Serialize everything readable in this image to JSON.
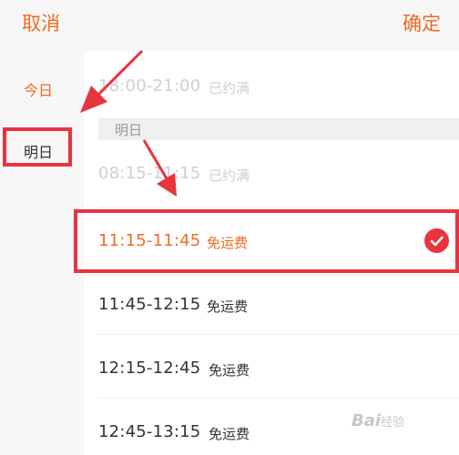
{
  "header": {
    "cancel_label": "取消",
    "confirm_label": "确定"
  },
  "sidebar": {
    "items": [
      {
        "label": "今日"
      },
      {
        "label": "明日"
      }
    ]
  },
  "slots": {
    "today": [
      {
        "time": "18:00-21:00",
        "status": "已约满"
      }
    ],
    "tomorrow_header": "明日",
    "tomorrow": [
      {
        "time": "08:15-11:15",
        "status": "已约满"
      },
      {
        "time": "11:15-11:45",
        "status": "免运费"
      },
      {
        "time": "11:45-12:15",
        "status": "免运费"
      },
      {
        "time": "12:15-12:45",
        "status": "免运费"
      },
      {
        "time": "12:45-13:15",
        "status": "免运费"
      }
    ]
  },
  "watermark": {
    "brand": "Bai",
    "text": "经验"
  },
  "colors": {
    "accent": "#f06a23",
    "annotation": "#e8343d",
    "disabled": "#cfcfcf"
  }
}
